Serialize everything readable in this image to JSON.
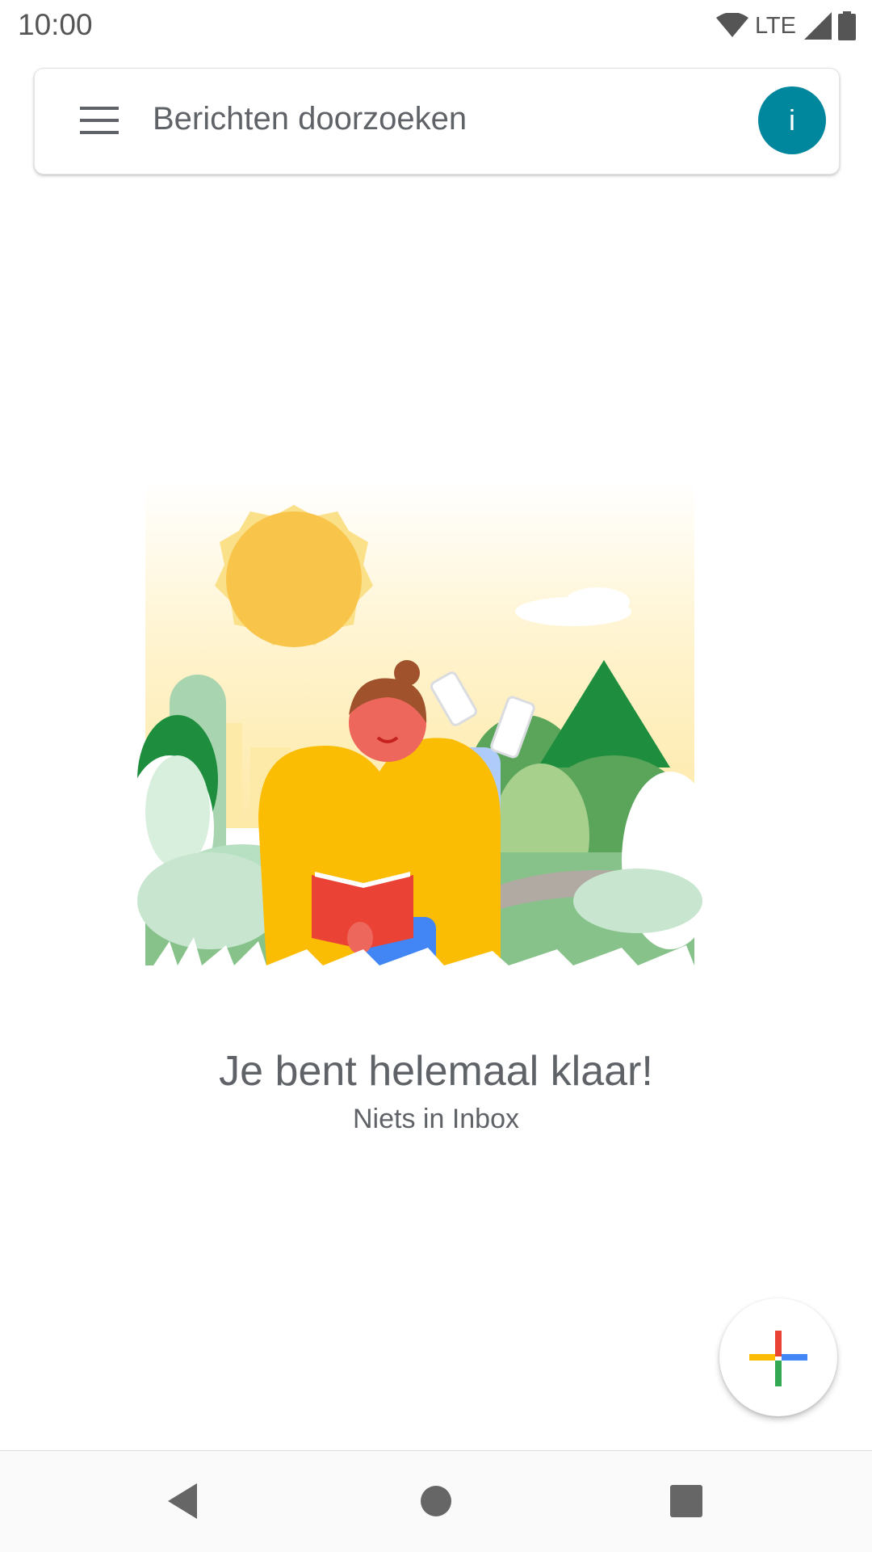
{
  "status_bar": {
    "time": "10:00",
    "network_label": "LTE",
    "icons": [
      "wifi-icon",
      "cell-signal-icon",
      "battery-icon"
    ]
  },
  "search": {
    "placeholder": "Berichten doorzoeken",
    "menu_icon": "hamburger-menu-icon",
    "avatar_letter": "i",
    "avatar_color": "#00879e"
  },
  "empty_state": {
    "title": "Je bent helemaal klaar!",
    "subtitle": "Niets in Inbox",
    "illustration": "person-reading-in-park-illustration"
  },
  "fab": {
    "icon": "compose-plus-icon",
    "colors": [
      "#ea4335",
      "#4285f4",
      "#34a853",
      "#fbbc04"
    ]
  },
  "nav_bar": {
    "buttons": [
      "back-icon",
      "home-icon",
      "recents-icon"
    ]
  }
}
